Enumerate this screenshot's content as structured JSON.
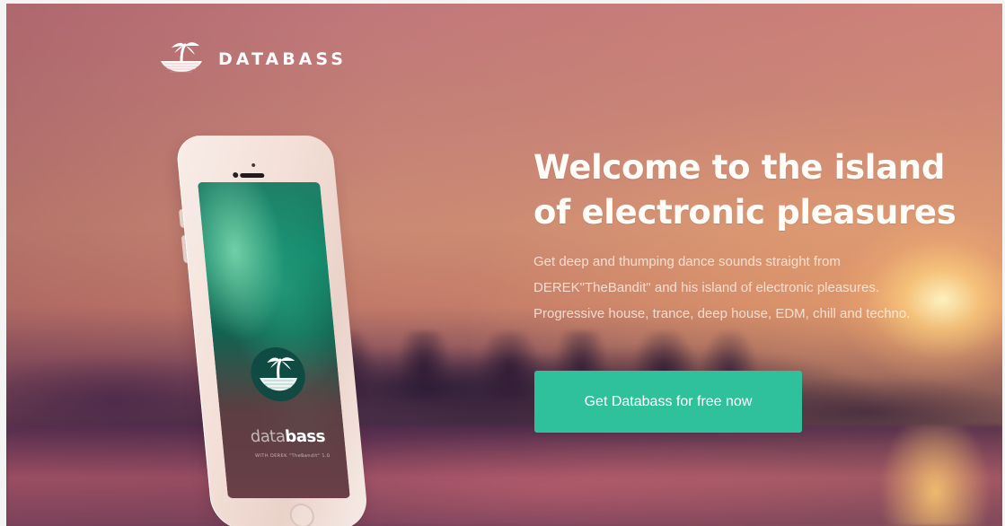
{
  "brand": {
    "name": "DATABASS",
    "icon": "palm-island-icon"
  },
  "hero": {
    "title": "Welcome to the island of electronic pleasures",
    "description": "Get deep and thumping dance sounds straight from DEREK\"TheBandit\" and his island of electronic pleasures. Progressive house, trance, deep house, EDM, chill and techno.",
    "cta_label": "Get Databass for free now"
  },
  "phone_app": {
    "title_light": "data",
    "title_bold": "bass",
    "subtitle": "WITH DEREK \"TheBandit\" 1.0",
    "icon": "palm-island-icon"
  },
  "colors": {
    "cta": "#2fc19c",
    "text": "#ffffff"
  }
}
